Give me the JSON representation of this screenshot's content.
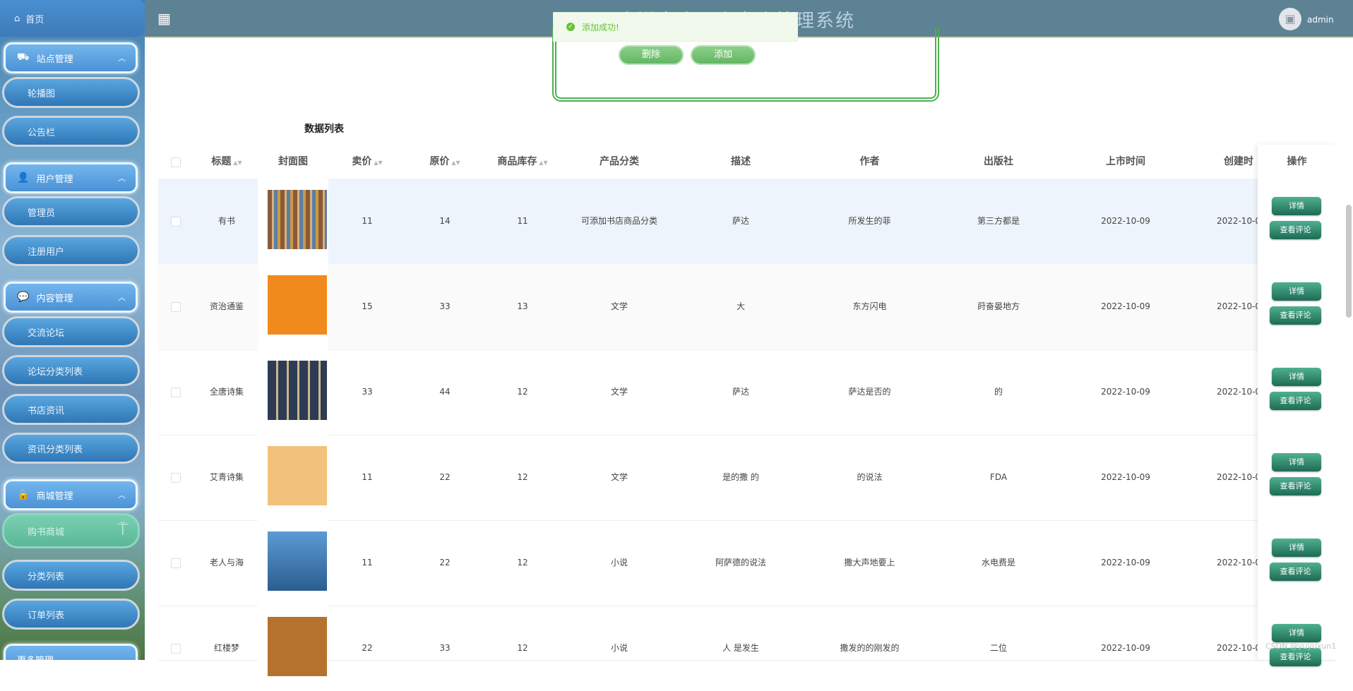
{
  "topbar": {
    "title": "南湖书店网上书店管理系统",
    "username": "admin"
  },
  "toast": {
    "message": "添加成功!"
  },
  "search_panel": {
    "delete_label": "删除",
    "add_label": "添加"
  },
  "sidebar": {
    "home": "首页",
    "groups": [
      {
        "label": "站点管理",
        "items": [
          "轮播图",
          "公告栏"
        ]
      },
      {
        "label": "用户管理",
        "items": [
          "管理员",
          "注册用户"
        ]
      },
      {
        "label": "内容管理",
        "items": [
          "交流论坛",
          "论坛分类列表",
          "书店资讯",
          "资讯分类列表"
        ]
      },
      {
        "label": "商城管理",
        "items": [
          "购书商城",
          "分类列表",
          "订单列表"
        ]
      },
      {
        "label": "更多管理",
        "items": []
      }
    ]
  },
  "table": {
    "title": "数据列表",
    "columns": [
      "标题",
      "封面图",
      "卖价",
      "原价",
      "商品库存",
      "产品分类",
      "描述",
      "作者",
      "出版社",
      "上市时间",
      "创建时",
      "操作"
    ],
    "rows": [
      {
        "title": "有书",
        "price": "11",
        "orig": "14",
        "stock": "11",
        "category": "可添加书店商品分类",
        "desc": "萨达",
        "author": "所发生的菲",
        "publisher": "第三方都是",
        "date": "2022-10-09",
        "created": "2022-10-0"
      },
      {
        "title": "资治通鉴",
        "price": "15",
        "orig": "33",
        "stock": "13",
        "category": "文学",
        "desc": "大",
        "author": "东方闪电",
        "publisher": "莳奋晏地方",
        "date": "2022-10-09",
        "created": "2022-10-0"
      },
      {
        "title": "全唐诗集",
        "price": "33",
        "orig": "44",
        "stock": "12",
        "category": "文学",
        "desc": "萨达",
        "author": "萨达是否的",
        "publisher": "的",
        "date": "2022-10-09",
        "created": "2022-10-0"
      },
      {
        "title": "艾青诗集",
        "price": "11",
        "orig": "22",
        "stock": "12",
        "category": "文学",
        "desc": "是的撒 的",
        "author": "的说法",
        "publisher": "FDA",
        "date": "2022-10-09",
        "created": "2022-10-0"
      },
      {
        "title": "老人与海",
        "price": "11",
        "orig": "22",
        "stock": "12",
        "category": "小说",
        "desc": "阿萨德的说法",
        "author": "撒大声地要上",
        "publisher": "水电费是",
        "date": "2022-10-09",
        "created": "2022-10-0"
      },
      {
        "title": "红楼梦",
        "price": "22",
        "orig": "33",
        "stock": "12",
        "category": "小说",
        "desc": "人 是发生",
        "author": "撒发的的刚发的",
        "publisher": "二位",
        "date": "2022-10-09",
        "created": "2022-10-0"
      }
    ],
    "detail_label": "详情",
    "review_label": "查看评论"
  },
  "watermark": "CSDN @yuyuxun1"
}
